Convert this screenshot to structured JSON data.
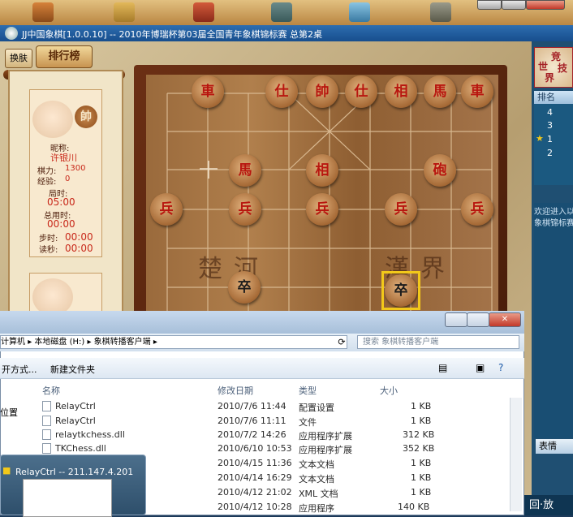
{
  "window": {
    "title": "JJ中国象棋[1.0.0.10] -- 2010年博瑞杯第03届全国青年象棋锦标赛 总第2桌"
  },
  "toolbar_game": {
    "drop_label": "换肤",
    "rank_label": "排行榜"
  },
  "player": {
    "role_piece": "帥",
    "nickname_label": "昵称:",
    "nickname": "许银川",
    "rating_label": "棋力:",
    "rating": "1300",
    "exp_label": "经验:",
    "exp": "0",
    "time_label": "局时:",
    "time": "05:00",
    "used_label": "总用时:",
    "used": "00:00",
    "step_label": "步时:",
    "step": "00:00",
    "read_label": "读秒:",
    "read": "00:00"
  },
  "board": {
    "pieces": [
      {
        "char": "車",
        "side": "red"
      },
      {
        "char": "仕",
        "side": "red"
      },
      {
        "char": "帥",
        "side": "red"
      },
      {
        "char": "仕",
        "side": "red"
      },
      {
        "char": "相",
        "side": "red"
      },
      {
        "char": "馬",
        "side": "red"
      },
      {
        "char": "車",
        "side": "red"
      },
      {
        "char": "馬",
        "side": "red"
      },
      {
        "char": "相",
        "side": "red"
      },
      {
        "char": "砲",
        "side": "red"
      },
      {
        "char": "兵",
        "side": "red"
      },
      {
        "char": "兵",
        "side": "red"
      },
      {
        "char": "兵",
        "side": "red"
      },
      {
        "char": "兵",
        "side": "red"
      },
      {
        "char": "兵",
        "side": "red"
      },
      {
        "char": "卒",
        "side": "black"
      },
      {
        "char": "卒",
        "side": "black"
      }
    ],
    "river_left": "楚河",
    "river_right": "漢界"
  },
  "right_panel": {
    "logo_chars": [
      "竞",
      "技",
      "世",
      "界"
    ],
    "rank_header": "排名",
    "ranks": [
      "4",
      "3",
      "1",
      "2"
    ],
    "star": "★",
    "msg1": "欢迎进入以",
    "msg2": "象棋锦标赛",
    "emoji_label": "表情",
    "play_label": "回·放"
  },
  "explorer": {
    "address": [
      "计算机",
      "本地磁盘 (H:)",
      "象棋转播客户端"
    ],
    "search_placeholder": "搜索 象棋转播客户端",
    "open_with": "开方式...",
    "new_folder": "新建文件夹",
    "left_item": "位置",
    "columns": {
      "name": "名称",
      "date": "修改日期",
      "type": "类型",
      "size": "大小"
    },
    "files": [
      {
        "name": "RelayCtrl",
        "date": "2010/7/6 11:44",
        "type": "配置设置",
        "size": "1 KB"
      },
      {
        "name": "RelayCtrl",
        "date": "2010/7/6 11:11",
        "type": "文件",
        "size": "1 KB"
      },
      {
        "name": "relaytkchess.dll",
        "date": "2010/7/2 14:26",
        "type": "应用程序扩展",
        "size": "312 KB"
      },
      {
        "name": "TKChess.dll",
        "date": "2010/6/10 10:53",
        "type": "应用程序扩展",
        "size": "352 KB"
      },
      {
        "name": "",
        "date": "2010/4/15 11:36",
        "type": "文本文档",
        "size": "1 KB"
      },
      {
        "name": "",
        "date": "2010/4/14 16:29",
        "type": "文本文档",
        "size": "1 KB"
      },
      {
        "name": "",
        "date": "2010/4/12 21:02",
        "type": "XML 文档",
        "size": "1 KB"
      },
      {
        "name": "",
        "date": "2010/4/12 10:28",
        "type": "应用程序",
        "size": "140 KB"
      }
    ]
  },
  "taskbar_preview": {
    "title": "RelayCtrl -- 211.147.4.201"
  }
}
